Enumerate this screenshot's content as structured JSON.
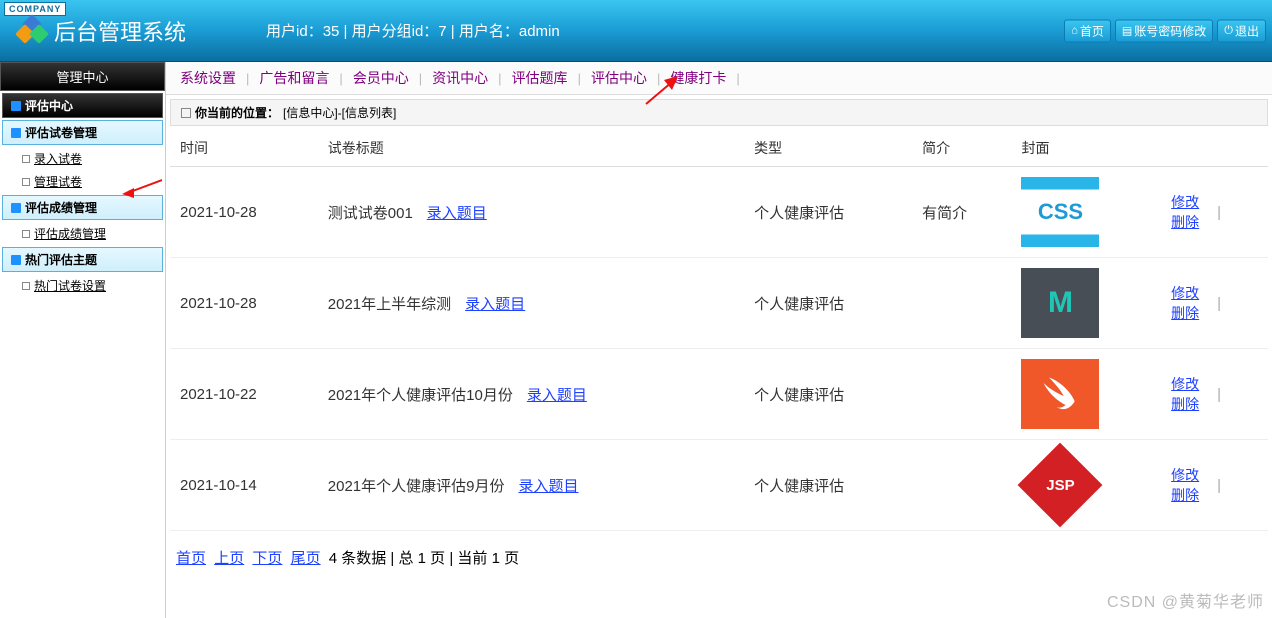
{
  "header": {
    "company": "COMPANY",
    "title": "后台管理系统",
    "user_info": "用户id：35 | 用户分组id：7 | 用户名：admin",
    "actions": {
      "home": "首页",
      "pwd": "账号密码修改",
      "logout": "退出"
    }
  },
  "topnav": [
    "系统设置",
    "广告和留言",
    "会员中心",
    "资讯中心",
    "评估题库",
    "评估中心",
    "健康打卡"
  ],
  "sidebar": {
    "center": "管理中心",
    "current": "评估中心",
    "groups": [
      {
        "title": "评估试卷管理",
        "items": [
          "录入试卷",
          "管理试卷"
        ]
      },
      {
        "title": "评估成绩管理",
        "items": [
          "评估成绩管理"
        ]
      },
      {
        "title": "热门评估主题",
        "items": [
          "热门试卷设置"
        ]
      }
    ]
  },
  "breadcrumb": {
    "prefix": "你当前的位置：",
    "path": "[信息中心]-[信息列表]"
  },
  "table": {
    "headers": [
      "时间",
      "试卷标题",
      "类型",
      "简介",
      "封面"
    ],
    "enter_label": "录入题目",
    "actions": {
      "edit": "修改",
      "del": "删除"
    },
    "rows": [
      {
        "date": "2021-10-28",
        "title": "测试试卷001",
        "type": "个人健康评估",
        "intro": "有简介",
        "cover": "css"
      },
      {
        "date": "2021-10-28",
        "title": "2021年上半年综测",
        "type": "个人健康评估",
        "intro": "",
        "cover": "m"
      },
      {
        "date": "2021-10-22",
        "title": "2021年个人健康评估10月份",
        "type": "个人健康评估",
        "intro": "",
        "cover": "swift"
      },
      {
        "date": "2021-10-14",
        "title": "2021年个人健康评估9月份",
        "type": "个人健康评估",
        "intro": "",
        "cover": "jsp"
      }
    ]
  },
  "pager": {
    "first": "首页",
    "prev": "上页",
    "next": "下页",
    "last": "尾页",
    "info": "4 条数据 | 总 1 页 | 当前 1 页"
  },
  "watermark": "CSDN @黄菊华老师"
}
